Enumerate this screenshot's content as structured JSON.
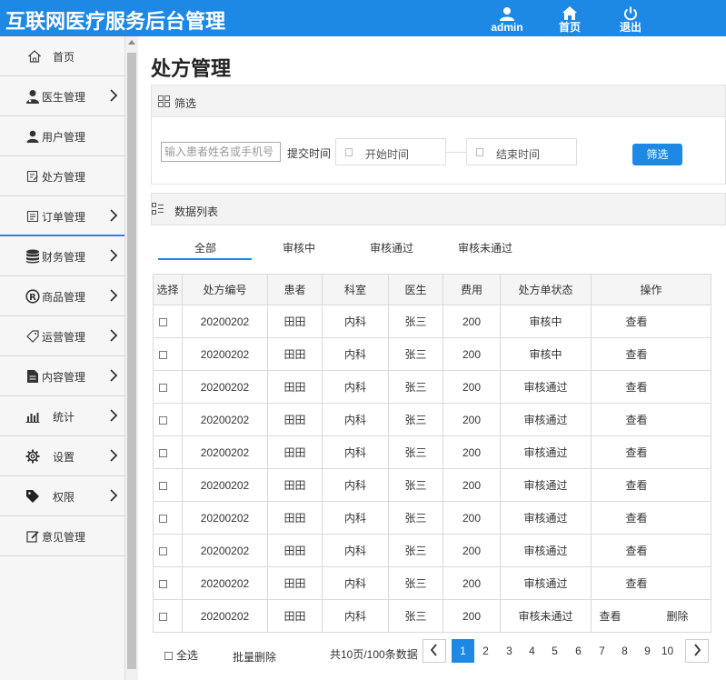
{
  "header": {
    "title": "互联网医疗服务后台管理",
    "user_label": "admin",
    "home_label": "首页",
    "logout_label": "退出"
  },
  "sidebar": {
    "items": [
      {
        "label": "首页",
        "icon": "home-icon",
        "has_arrow": false
      },
      {
        "label": "医生管理",
        "icon": "doctor-icon",
        "has_arrow": true
      },
      {
        "label": "用户管理",
        "icon": "user-icon",
        "has_arrow": false
      },
      {
        "label": "处方管理",
        "icon": "prescription-icon",
        "has_arrow": false
      },
      {
        "label": "订单管理",
        "icon": "order-icon",
        "has_arrow": true
      },
      {
        "label": "财务管理",
        "icon": "database-icon",
        "has_arrow": true
      },
      {
        "label": "商品管理",
        "icon": "registered-icon",
        "has_arrow": true
      },
      {
        "label": "运营管理",
        "icon": "tag-outline-icon",
        "has_arrow": true
      },
      {
        "label": "内容管理",
        "icon": "document-icon",
        "has_arrow": true
      },
      {
        "label": "统计",
        "icon": "bar-chart-icon",
        "has_arrow": true
      },
      {
        "label": "设置",
        "icon": "gear-icon",
        "has_arrow": true
      },
      {
        "label": "权限",
        "icon": "tag-icon",
        "has_arrow": true
      },
      {
        "label": "意见管理",
        "icon": "edit-icon",
        "has_arrow": false
      }
    ]
  },
  "page_title": "处方管理",
  "filter": {
    "title": "筛选",
    "search_placeholder": "输入患者姓名或手机号",
    "submit_time_label": "提交时间",
    "start_time": "开始时间",
    "end_time": "结束时间",
    "button_label": "筛选"
  },
  "list": {
    "title": "数据列表",
    "tabs": [
      "全部",
      "审核中",
      "审核通过",
      "审核未通过"
    ],
    "columns": [
      "选择",
      "处方编号",
      "患者",
      "科室",
      "医生",
      "费用",
      "处方单状态",
      "操作"
    ],
    "view_label": "查看",
    "delete_label": "删除",
    "rows": [
      {
        "id": "20200202",
        "patient": "田田",
        "dept": "内科",
        "doctor": "张三",
        "fee": "200",
        "status": "审核中",
        "deletable": false
      },
      {
        "id": "20200202",
        "patient": "田田",
        "dept": "内科",
        "doctor": "张三",
        "fee": "200",
        "status": "审核中",
        "deletable": false
      },
      {
        "id": "20200202",
        "patient": "田田",
        "dept": "内科",
        "doctor": "张三",
        "fee": "200",
        "status": "审核通过",
        "deletable": false
      },
      {
        "id": "20200202",
        "patient": "田田",
        "dept": "内科",
        "doctor": "张三",
        "fee": "200",
        "status": "审核通过",
        "deletable": false
      },
      {
        "id": "20200202",
        "patient": "田田",
        "dept": "内科",
        "doctor": "张三",
        "fee": "200",
        "status": "审核通过",
        "deletable": false
      },
      {
        "id": "20200202",
        "patient": "田田",
        "dept": "内科",
        "doctor": "张三",
        "fee": "200",
        "status": "审核通过",
        "deletable": false
      },
      {
        "id": "20200202",
        "patient": "田田",
        "dept": "内科",
        "doctor": "张三",
        "fee": "200",
        "status": "审核通过",
        "deletable": false
      },
      {
        "id": "20200202",
        "patient": "田田",
        "dept": "内科",
        "doctor": "张三",
        "fee": "200",
        "status": "审核通过",
        "deletable": false
      },
      {
        "id": "20200202",
        "patient": "田田",
        "dept": "内科",
        "doctor": "张三",
        "fee": "200",
        "status": "审核通过",
        "deletable": false
      },
      {
        "id": "20200202",
        "patient": "田田",
        "dept": "内科",
        "doctor": "张三",
        "fee": "200",
        "status": "审核未通过",
        "deletable": true
      }
    ]
  },
  "footer": {
    "select_all_label": "全选",
    "batch_delete_label": "批量删除",
    "page_info": "共10页/100条数据",
    "pages": [
      "1",
      "2",
      "3",
      "4",
      "5",
      "6",
      "7",
      "8",
      "9",
      "10"
    ],
    "current_page": "1"
  },
  "colors": {
    "accent": "#1e88e5"
  }
}
